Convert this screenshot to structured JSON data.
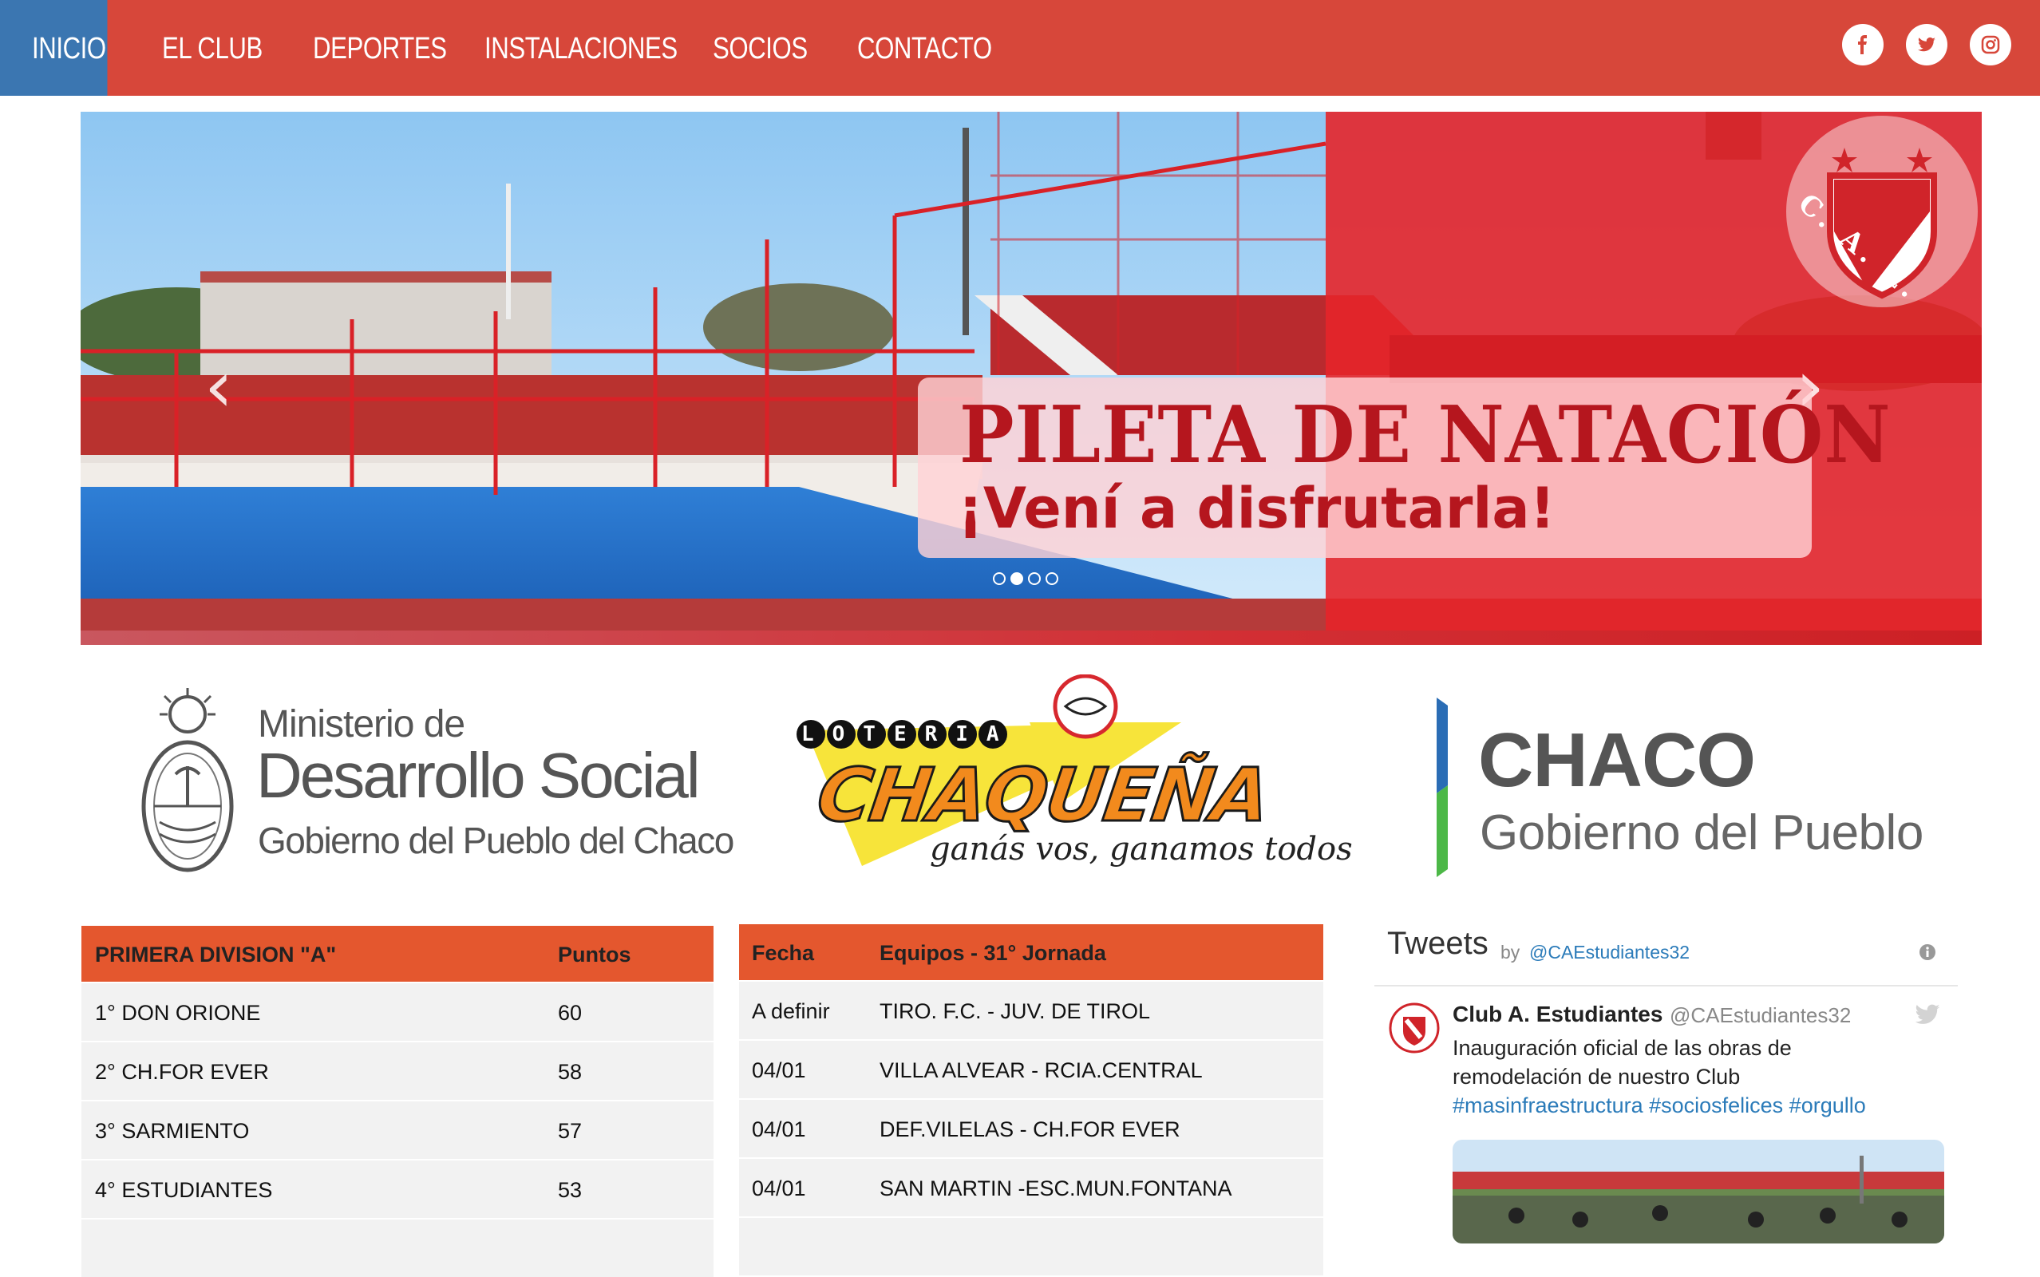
{
  "nav": {
    "items": [
      {
        "label": "INICIO"
      },
      {
        "label": "EL CLUB"
      },
      {
        "label": "DEPORTES"
      },
      {
        "label": "INSTALACIONES"
      },
      {
        "label": "SOCIOS"
      },
      {
        "label": "CONTACTO"
      }
    ],
    "active_index": 0,
    "social_icons": [
      "facebook-icon",
      "twitter-icon",
      "instagram-icon"
    ]
  },
  "hero": {
    "title": "PILETA DE NATACIÓN",
    "subtitle": "¡Vení a disfrutarla!",
    "logo_text": "C. A. E.",
    "slide_count": 4,
    "active_slide": 1,
    "prev_glyph": "‹",
    "next_glyph": "›"
  },
  "sponsors": {
    "ministerio": {
      "line1": "Ministerio de",
      "line2": "Desarrollo Social",
      "line3": "Gobierno del Pueblo del Chaco"
    },
    "loteria": {
      "word1": "LOTERIA",
      "word2": "CHAQUEÑA",
      "slogan": "ganás vos, ganamos todos"
    },
    "chaco": {
      "line1": "CHACO",
      "line2": "Gobierno del Pueblo"
    }
  },
  "standings": {
    "header": {
      "team": "PRIMERA DIVISION \"A\"",
      "points": "Puntos"
    },
    "rows": [
      {
        "team": "1° DON ORIONE",
        "points": "60"
      },
      {
        "team": "2° CH.FOR EVER",
        "points": "58"
      },
      {
        "team": "3° SARMIENTO",
        "points": "57"
      },
      {
        "team": "4° ESTUDIANTES",
        "points": "53"
      }
    ]
  },
  "fixtures": {
    "header": {
      "date": "Fecha",
      "teams": "Equipos - 31° Jornada"
    },
    "rows": [
      {
        "date": "A definir",
        "teams": "TIRO. F.C. - JUV. DE TIROL"
      },
      {
        "date": "04/01",
        "teams": "VILLA ALVEAR - RCIA.CENTRAL"
      },
      {
        "date": "04/01",
        "teams": "DEF.VILELAS - CH.FOR EVER"
      },
      {
        "date": "04/01",
        "teams": "SAN MARTIN -ESC.MUN.FONTANA"
      }
    ]
  },
  "tweets": {
    "title": "Tweets",
    "by": "by",
    "handle": "@CAEstudiantes32",
    "tweet": {
      "name": "Club A. Estudiantes",
      "user": "@CAEstudiantes32",
      "text_line1": "Inauguración oficial de las obras de",
      "text_line2": "remodelación de nuestro Club",
      "hashtags": "#masinfraestructura #sociosfelices #orgullo"
    }
  },
  "colors": {
    "nav_bg": "#d7473a",
    "nav_active": "#3b76b1",
    "table_header": "#e4572e",
    "row_bg": "#f2f2f2",
    "accent_red": "#b5161e",
    "link_blue": "#2b7bb9"
  }
}
